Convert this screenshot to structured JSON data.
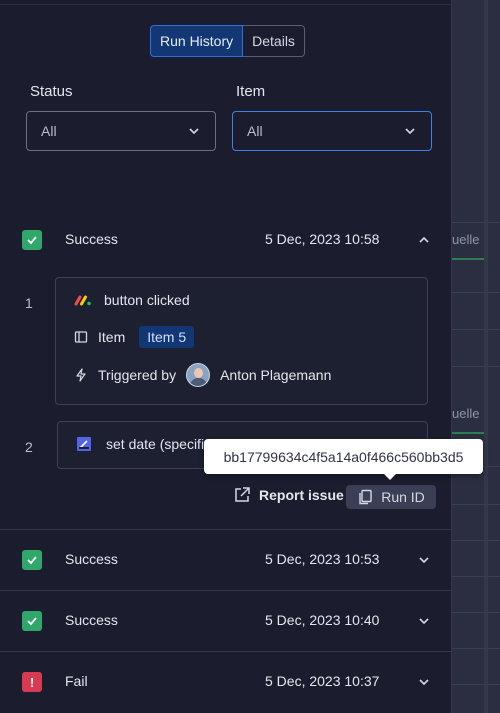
{
  "tabs": [
    {
      "label": "Run History",
      "active": true
    },
    {
      "label": "Details",
      "active": false
    }
  ],
  "filters": {
    "status": {
      "label": "Status",
      "value": "All"
    },
    "item": {
      "label": "Item",
      "value": "All"
    }
  },
  "runs": [
    {
      "status": "Success",
      "date": "5 Dec, 2023 10:58",
      "expanded": true
    },
    {
      "status": "Success",
      "date": "5 Dec, 2023 10:53",
      "expanded": false
    },
    {
      "status": "Success",
      "date": "5 Dec, 2023 10:40",
      "expanded": false
    },
    {
      "status": "Fail",
      "date": "5 Dec, 2023 10:37",
      "expanded": false
    }
  ],
  "steps": [
    {
      "number": "1",
      "trigger_title": "button clicked",
      "item_label": "Item",
      "item_badge": "Item 5",
      "triggered_by_label": "Triggered by",
      "triggered_by_user": "Anton Plagemann"
    },
    {
      "number": "2",
      "action_title": "set date (specific)"
    }
  ],
  "actions": {
    "report_issue": "Report issue",
    "run_id": "Run ID"
  },
  "tooltip": {
    "text": "bb17799634c4f5a14a0f466c560bb3d5"
  },
  "background": {
    "cell_text_1": "uelle",
    "cell_text_2": "uelle"
  },
  "colors": {
    "panel_bg": "#1b1d2e",
    "accent_blue": "#2f6fde",
    "success_green": "#2fa66a",
    "fail_red": "#d83a52",
    "badge_bg": "#133774"
  },
  "icons": {
    "success": "checkmark-icon",
    "fail": "exclamation-icon",
    "chevron": "chevron-icon",
    "monday_logo": "monday-logo-icon",
    "item": "item-icon",
    "trigger": "lightning-icon",
    "date": "date-pencil-icon",
    "external": "external-link-icon",
    "copy": "copy-icon"
  }
}
